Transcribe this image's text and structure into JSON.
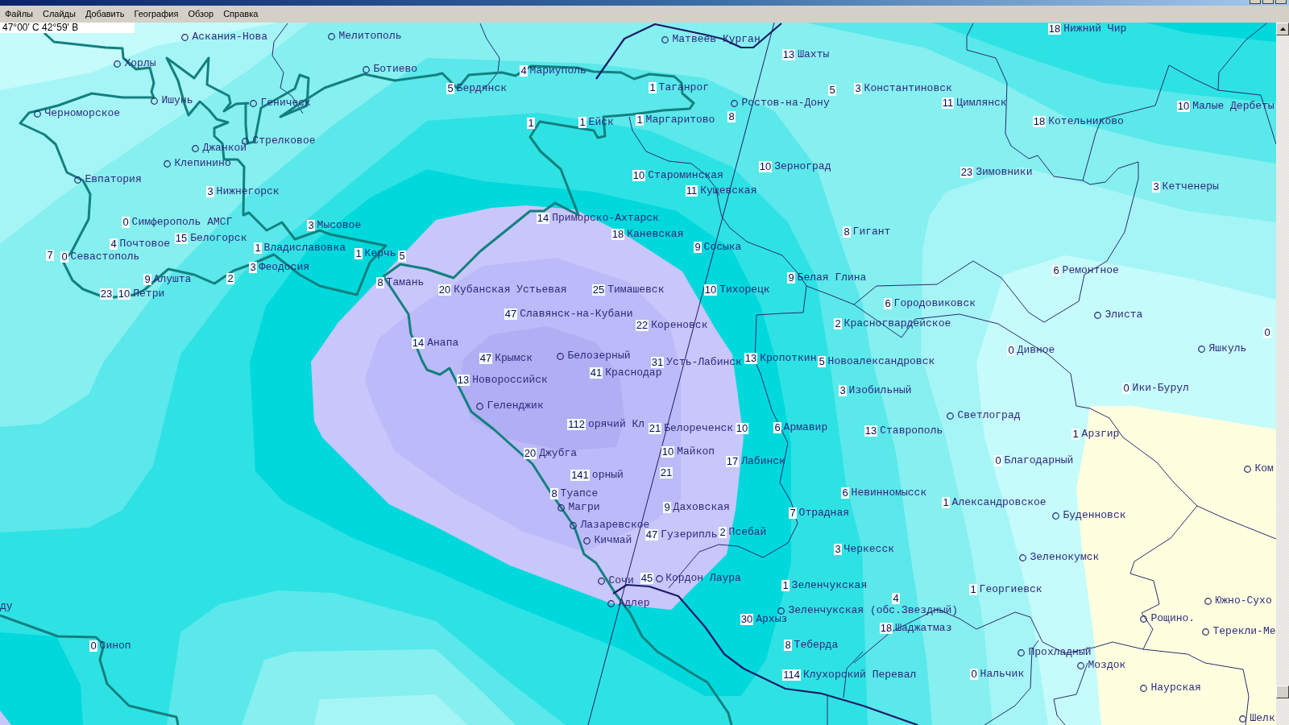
{
  "menu": [
    {
      "label": "Файлы"
    },
    {
      "label": "Слайды"
    },
    {
      "label": "Добавить"
    },
    {
      "label": "География"
    },
    {
      "label": "Обзор"
    },
    {
      "label": "Справка"
    }
  ],
  "coordinates": "47°00' С 42°59' В",
  "map": {
    "stations": [
      {
        "kind": "circle",
        "name": "Аскания-Нова"
      },
      {
        "kind": "circle",
        "name": "Мелитополь"
      },
      {
        "kind": "circle",
        "name": "Матвеев Курган"
      },
      {
        "kind": "value",
        "value": "18",
        "name": "Нижний Чир"
      },
      {
        "kind": "value",
        "value": "13",
        "name": "Шахты"
      },
      {
        "kind": "circle",
        "name": "Хорлы"
      },
      {
        "kind": "circle",
        "name": "Ботиево"
      },
      {
        "kind": "value",
        "value": "4",
        "name": "Мариуполь"
      },
      {
        "kind": "value",
        "value": "5",
        "name": "Бердянск"
      },
      {
        "kind": "value",
        "value": "1",
        "name": "Таганрог"
      },
      {
        "kind": "value",
        "value": "5"
      },
      {
        "kind": "value",
        "value": "3",
        "name": "Константиновск"
      },
      {
        "kind": "circle",
        "name": "Ишунь"
      },
      {
        "kind": "circle",
        "name": "Геническ"
      },
      {
        "kind": "circle",
        "name": "Ростов-на-Дону"
      },
      {
        "kind": "value",
        "value": "11",
        "name": "Цимлянск"
      },
      {
        "kind": "value",
        "value": "10",
        "name": "Малые Дербеты"
      },
      {
        "kind": "circle",
        "name": "Черноморское"
      },
      {
        "kind": "value",
        "value": "1"
      },
      {
        "kind": "value",
        "value": "1",
        "name": "Ейск"
      },
      {
        "kind": "value",
        "value": "1",
        "name": "Маргаритово"
      },
      {
        "kind": "value",
        "value": "8"
      },
      {
        "kind": "value",
        "value": "18",
        "name": "Котельниково"
      },
      {
        "kind": "circle",
        "name": "Стрелковое"
      },
      {
        "kind": "circle",
        "name": "Джанкой"
      },
      {
        "kind": "circle",
        "name": "Клепинино"
      },
      {
        "kind": "value",
        "value": "10",
        "name": "Зерноград"
      },
      {
        "kind": "value",
        "value": "10",
        "name": "Староминская"
      },
      {
        "kind": "value",
        "value": "23",
        "name": "Зимовники"
      },
      {
        "kind": "circle",
        "name": "Евпатория"
      },
      {
        "kind": "value",
        "value": "3",
        "name": "Нижнегорск"
      },
      {
        "kind": "value",
        "value": "11",
        "name": "Кущевская"
      },
      {
        "kind": "value",
        "value": "3",
        "name": "Кетченеры"
      },
      {
        "kind": "value",
        "value": "0",
        "name": "Симферополь АМСГ"
      },
      {
        "kind": "value",
        "value": "3",
        "name": "Мысовое"
      },
      {
        "kind": "value",
        "value": "14",
        "name": "Приморско-Ахтарск"
      },
      {
        "kind": "value",
        "value": "15",
        "name": "Белогорск"
      },
      {
        "kind": "value",
        "value": "18",
        "name": "Каневская"
      },
      {
        "kind": "value",
        "value": "8",
        "name": "Гигант"
      },
      {
        "kind": "value",
        "value": "4",
        "name": "Почтовое"
      },
      {
        "kind": "value",
        "value": "1",
        "name": "Владиславовка"
      },
      {
        "kind": "value",
        "value": "9",
        "name": "Сосыка"
      },
      {
        "kind": "value",
        "value": "7"
      },
      {
        "kind": "value",
        "value": "0",
        "name": "Севастополь"
      },
      {
        "kind": "value",
        "value": "1",
        "name": "Керчь"
      },
      {
        "kind": "value",
        "value": "5"
      },
      {
        "kind": "value",
        "value": "3",
        "name": "Феодосия"
      },
      {
        "kind": "value",
        "value": "6",
        "name": "Ремонтное"
      },
      {
        "kind": "value",
        "value": "9",
        "name": "Алушта"
      },
      {
        "kind": "value",
        "value": "2"
      },
      {
        "kind": "value",
        "value": "8",
        "name": "Тамань"
      },
      {
        "kind": "value",
        "value": "9",
        "name": "Белая Глина"
      },
      {
        "kind": "value",
        "value": "23"
      },
      {
        "kind": "value",
        "value": "10",
        "name": "Петри"
      },
      {
        "kind": "value",
        "value": "20",
        "name": "Кубанская Устьевая"
      },
      {
        "kind": "value",
        "value": "25",
        "name": "Тимашевск"
      },
      {
        "kind": "value",
        "value": "10",
        "name": "Тихорецк"
      },
      {
        "kind": "value",
        "value": "6",
        "name": "Городовиковск"
      },
      {
        "kind": "value",
        "value": "47",
        "name": "Славянск-на-Кубани"
      },
      {
        "kind": "circle",
        "name": "Элиста"
      },
      {
        "kind": "value",
        "value": "22",
        "name": "Кореновск"
      },
      {
        "kind": "value",
        "value": "2",
        "name": "Красногвардейское"
      },
      {
        "kind": "value",
        "value": "0"
      },
      {
        "kind": "value",
        "value": "14",
        "name": "Анапа"
      },
      {
        "kind": "value",
        "value": "0",
        "name": "Дивное"
      },
      {
        "kind": "circle",
        "name": "Яшкуль"
      },
      {
        "kind": "value",
        "value": "47",
        "name": "Крымск"
      },
      {
        "kind": "circle",
        "name": "Белозерный"
      },
      {
        "kind": "value",
        "value": "31",
        "name": "Усть-Лабинск"
      },
      {
        "kind": "value",
        "value": "13",
        "name": "Кропоткин"
      },
      {
        "kind": "value",
        "value": "5",
        "name": "Новоалександровск"
      },
      {
        "kind": "value",
        "value": "41",
        "name": "Краснодар"
      },
      {
        "kind": "value",
        "value": "13",
        "name": "Новороссийск"
      },
      {
        "kind": "value",
        "value": "3",
        "name": "Изобильный"
      },
      {
        "kind": "value",
        "value": "0",
        "name": "Ики-Бурул"
      },
      {
        "kind": "circle",
        "name": "Геленджик"
      },
      {
        "kind": "circle",
        "name": "Светлоград"
      },
      {
        "kind": "value",
        "value": "112",
        "name": "орячий Кл"
      },
      {
        "kind": "value",
        "value": "21",
        "name": "Белореченск"
      },
      {
        "kind": "value",
        "value": "10"
      },
      {
        "kind": "value",
        "value": "6",
        "name": "Армавир"
      },
      {
        "kind": "value",
        "value": "13",
        "name": "Ставрополь"
      },
      {
        "kind": "value",
        "value": "1",
        "name": "Арзгир"
      },
      {
        "kind": "value",
        "value": "20",
        "name": "Джубга"
      },
      {
        "kind": "value",
        "value": "10",
        "name": "Майкоп"
      },
      {
        "kind": "value",
        "value": "17",
        "name": "Лабинск"
      },
      {
        "kind": "value",
        "value": "0",
        "name": "Благодарный"
      },
      {
        "kind": "circle",
        "name": "Ком"
      },
      {
        "kind": "value",
        "value": "141",
        "name": "орный"
      },
      {
        "kind": "value",
        "value": "21"
      },
      {
        "kind": "value",
        "value": "8",
        "name": "Туапсе"
      },
      {
        "kind": "value",
        "value": "6",
        "name": "Невинномысск"
      },
      {
        "kind": "value",
        "value": "1",
        "name": "Александровское"
      },
      {
        "kind": "circle",
        "name": "Магри"
      },
      {
        "kind": "value",
        "value": "9",
        "name": "Даховская"
      },
      {
        "kind": "value",
        "value": "7",
        "name": "Отрадная"
      },
      {
        "kind": "circle",
        "name": "Буденновск"
      },
      {
        "kind": "circle",
        "name": "Лазаревское"
      },
      {
        "kind": "value",
        "value": "47",
        "name": "Гузерипль"
      },
      {
        "kind": "value",
        "value": "2",
        "name": "Псебай"
      },
      {
        "kind": "circle",
        "name": "Кичмай"
      },
      {
        "kind": "value",
        "value": "3",
        "name": "Черкесск"
      },
      {
        "kind": "circle",
        "name": "Зеленокумск"
      },
      {
        "kind": "circle",
        "name": "Сочи"
      },
      {
        "kind": "value_circle",
        "value": "45",
        "name": "Кордон Лаура"
      },
      {
        "kind": "value",
        "value": "1",
        "name": "Зеленчукская"
      },
      {
        "kind": "value",
        "value": "1",
        "name": "Георгиевск"
      },
      {
        "kind": "text",
        "name": "ду"
      },
      {
        "kind": "circle",
        "name": "Адлер"
      },
      {
        "kind": "value",
        "value": "4"
      },
      {
        "kind": "circle",
        "name": "Южно-Сухо"
      },
      {
        "kind": "circle",
        "name": "Зеленчукская (обс.Звездный)"
      },
      {
        "kind": "value",
        "value": "30",
        "name": "Архыз"
      },
      {
        "kind": "circle",
        "name": "Рощино."
      },
      {
        "kind": "value",
        "value": "18",
        "name": "Шаджатмаз"
      },
      {
        "kind": "circle",
        "name": "Терекли-Ме"
      },
      {
        "kind": "value",
        "value": "0",
        "name": "Синоп"
      },
      {
        "kind": "value",
        "value": "8",
        "name": "Теберда"
      },
      {
        "kind": "circle",
        "name": "Прохладный"
      },
      {
        "kind": "circle",
        "name": "Моздок"
      },
      {
        "kind": "value",
        "value": "114",
        "name": "Клухорский Перевал"
      },
      {
        "kind": "value",
        "value": "0",
        "name": "Нальчик"
      },
      {
        "kind": "circle",
        "name": "Наурская"
      },
      {
        "kind": "circle",
        "name": "Шелк"
      }
    ]
  }
}
